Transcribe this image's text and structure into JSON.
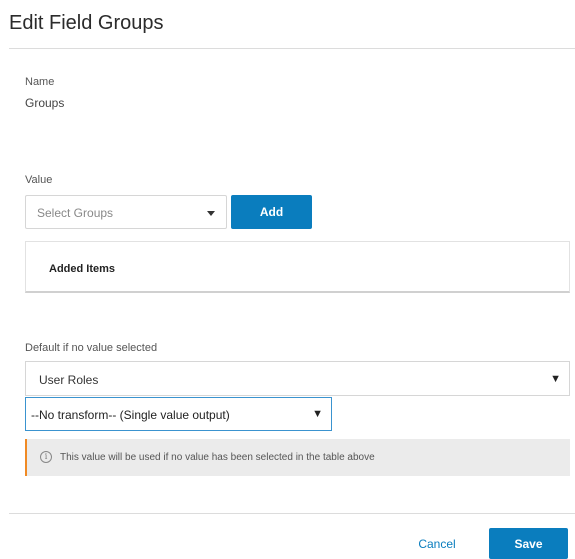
{
  "dialog": {
    "title": "Edit Field Groups"
  },
  "name_field": {
    "label": "Name",
    "value": "Groups"
  },
  "value_field": {
    "label": "Value",
    "select_placeholder": "Select Groups",
    "add_label": "Add"
  },
  "added_items": {
    "title": "Added Items"
  },
  "default_field": {
    "label": "Default if no value selected",
    "selected": "User Roles",
    "transform_selected": "--No transform-- (Single value output)",
    "arrow_glyph": "▼",
    "info_glyph": "i",
    "info_text": "This value will be used if no value has been selected in the table above"
  },
  "footer": {
    "cancel_label": "Cancel",
    "save_label": "Save"
  },
  "colors": {
    "primary": "#0a7dbe",
    "warning_accent": "#f08a24",
    "info_bg": "#ebebeb"
  }
}
